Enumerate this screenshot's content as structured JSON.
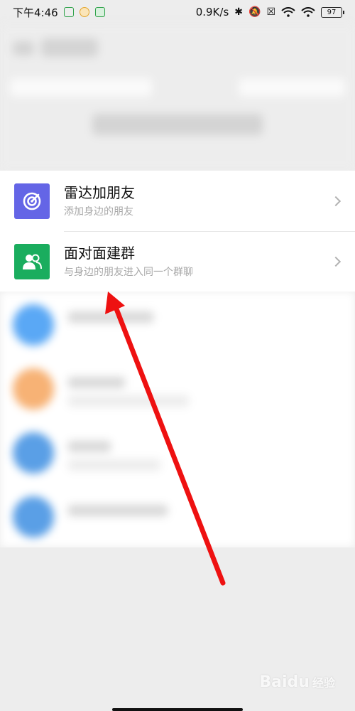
{
  "status_bar": {
    "time": "下午4:46",
    "network_speed": "0.9K/s",
    "battery": "97"
  },
  "menu": [
    {
      "title": "雷达加朋友",
      "subtitle": "添加身边的朋友",
      "icon": "radar-icon",
      "color": "#6465e6"
    },
    {
      "title": "面对面建群",
      "subtitle": "与身边的朋友进入同一个群聊",
      "icon": "group-icon",
      "color": "#1aad5e"
    }
  ],
  "watermark": {
    "brand": "Baidu",
    "sub": "经验"
  },
  "blurred_avatar_colors": [
    "#5aa8f5",
    "#f7b275",
    "#5a9fe6",
    "#5a9fe6"
  ]
}
